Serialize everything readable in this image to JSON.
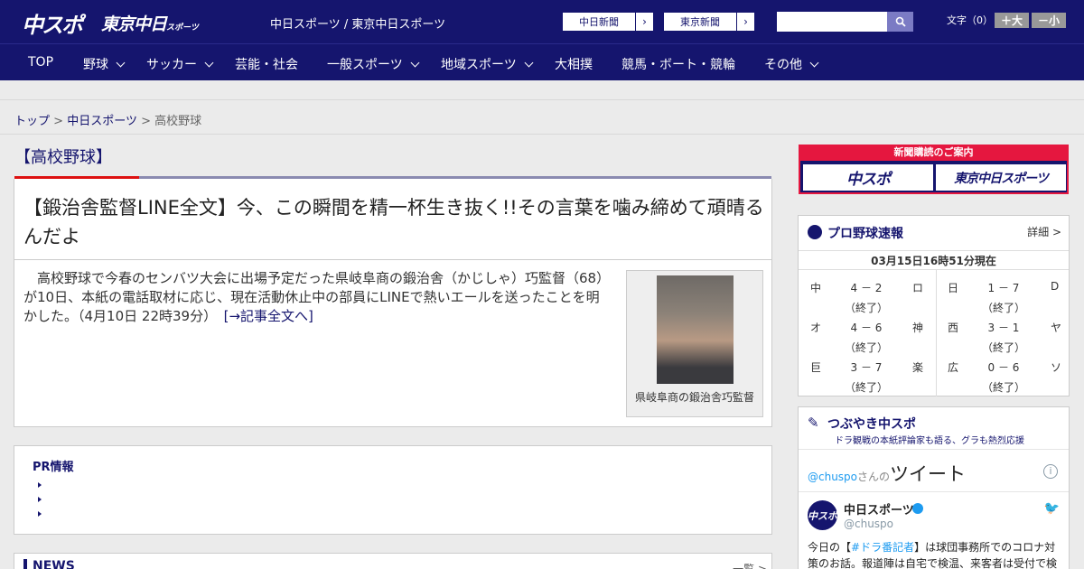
{
  "header": {
    "logo_chuspo": "中スポ",
    "logo_tokyo": "東京中日",
    "logo_tokyo_small": "スポーツ",
    "site_title": "中日スポーツ / 東京中日スポーツ",
    "paper_links": [
      "中日新聞",
      "東京新聞"
    ],
    "search_value": "",
    "fontsize_label": "文字（0）",
    "font_bigger": "＋大",
    "font_smaller": "－小"
  },
  "nav": [
    "TOP",
    "野球",
    "サッカー",
    "芸能・社会",
    "一般スポーツ",
    "地域スポーツ",
    "大相撲",
    "競馬・ボート・競輪",
    "その他"
  ],
  "breadcrumb": {
    "home": "トップ",
    "sep": ">",
    "parent": "中日スポーツ",
    "current": "高校野球"
  },
  "main": {
    "section_title": "【高校野球】",
    "headline": "【鍛治舎監督LINE全文】今、この瞬間を精一杯生き抜く!!その言葉を噛み締めて頑晴るんだよ",
    "lead": "高校野球で今春のセンバツ大会に出場予定だった県岐阜商の鍛治舎（かじしゃ）巧監督（68）が10日、本紙の電話取材に応じ、現在活動休止中の部員にLINEで熱いエールを送ったことを明かした。（4月10日 22時39分）",
    "more_link": "[→記事全文へ]",
    "photo_caption": "県岐阜商の鍛治舎巧監督",
    "pr_title": "PR情報",
    "news_title": "NEWS",
    "news_more": "一覧 >"
  },
  "sidebar": {
    "subscribe_head": "新聞購読のご案内",
    "subscribe_logos": [
      "中スポ",
      "東京中日スポーツ"
    ],
    "scores": {
      "title": "プロ野球速報",
      "detail": "詳細 >",
      "updated": "03月15日16時51分現在",
      "games": [
        {
          "home": "中",
          "score": "4 － 2",
          "away": "ロ",
          "status": "（終了）"
        },
        {
          "home": "オ",
          "score": "4 － 6",
          "away": "神",
          "status": "（終了）"
        },
        {
          "home": "巨",
          "score": "3 － 7",
          "away": "楽",
          "status": "（終了）"
        },
        {
          "home": "日",
          "score": "1 － 7",
          "away": "D",
          "status": "（終了）"
        },
        {
          "home": "西",
          "score": "3 － 1",
          "away": "ヤ",
          "status": "（終了）"
        },
        {
          "home": "広",
          "score": "0 － 6",
          "away": "ソ",
          "status": "（終了）"
        }
      ]
    },
    "tweets": {
      "title": "つぶやき中スポ",
      "subtitle": "ドラ観戦の本紙評論家も語る、グラも熱烈応援",
      "handle_link": "@chuspo",
      "handle_suffix": "さんの",
      "handle_big": "ツイート",
      "avatar_text": "中スポ",
      "account_name": "中日スポーツ",
      "account_at": "@chuspo",
      "tweet_prefix": "今日の【",
      "tweet_hashtag": "#ドラ番記者",
      "tweet_body": "】は球団事務所でのコロナ対策のお話。報道陣は自宅で検温、来客者は受付で検"
    }
  }
}
